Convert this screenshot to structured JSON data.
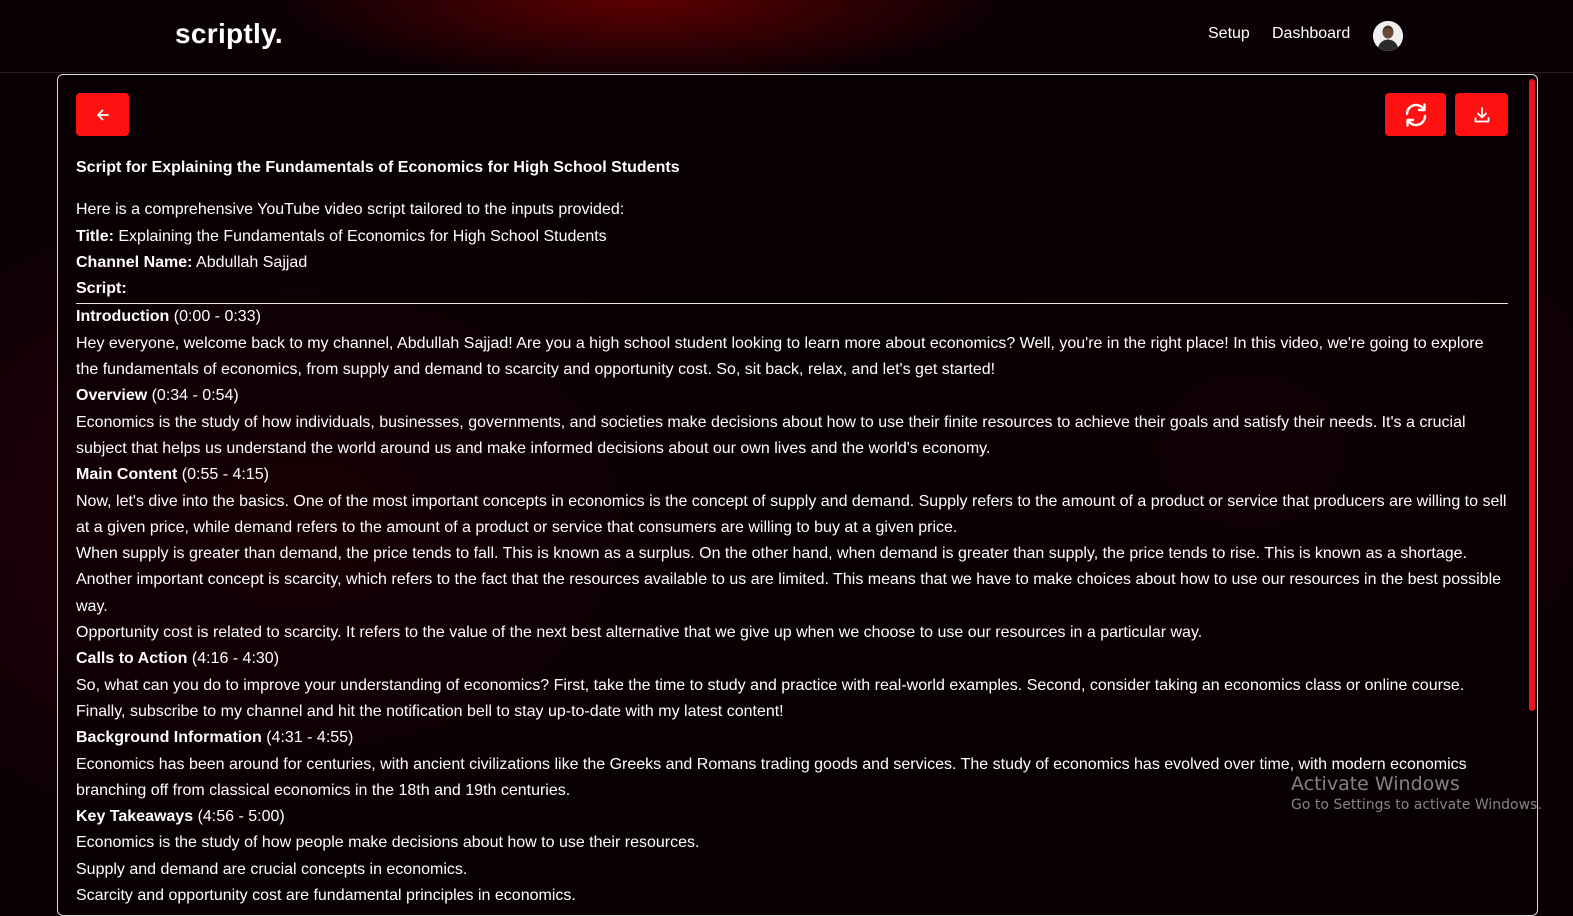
{
  "header": {
    "logo": "scriptly.",
    "nav": [
      "Setup",
      "Dashboard"
    ],
    "avatar_icon": "user-avatar"
  },
  "toolbar": {
    "back_icon": "arrow-left-icon",
    "refresh_icon": "refresh-icon",
    "download_icon": "download-icon",
    "accent_color": "#ff1111"
  },
  "script": {
    "heading": "Script for Explaining the Fundamentals of Economics for High School Students",
    "intro_line": "Here is a comprehensive YouTube video script tailored to the inputs provided:",
    "title_label": "Title:",
    "title_value": " Explaining the Fundamentals of Economics for High School Students",
    "channel_label": "Channel Name:",
    "channel_value": " Abdullah Sajjad",
    "script_label": "Script:",
    "sections": [
      {
        "label": "Introduction",
        "time": " (0:00 - 0:33)"
      },
      {
        "label": "Overview",
        "time": " (0:34 - 0:54)"
      },
      {
        "label": "Main Content",
        "time": " (0:55 - 4:15)"
      },
      {
        "label": "Calls to Action",
        "time": " (4:16 - 4:30)"
      },
      {
        "label": "Background Information",
        "time": " (4:31 - 4:55)"
      },
      {
        "label": "Key Takeaways",
        "time": " (4:56 - 5:00)"
      }
    ],
    "intro_text": "Hey everyone, welcome back to my channel, Abdullah Sajjad! Are you a high school student looking to learn more about economics? Well, you're in the right place! In this video, we're going to explore the fundamentals of economics, from supply and demand to scarcity and opportunity cost. So, sit back, relax, and let's get started!",
    "overview_text": "Economics is the study of how individuals, businesses, governments, and societies make decisions about how to use their finite resources to achieve their goals and satisfy their needs. It's a crucial subject that helps us understand the world around us and make informed decisions about our own lives and the world's economy.",
    "main_p1": "Now, let's dive into the basics. One of the most important concepts in economics is the concept of supply and demand. Supply refers to the amount of a product or service that producers are willing to sell at a given price, while demand refers to the amount of a product or service that consumers are willing to buy at a given price.",
    "main_p2": "When supply is greater than demand, the price tends to fall. This is known as a surplus. On the other hand, when demand is greater than supply, the price tends to rise. This is known as a shortage.",
    "main_p3": "Another important concept is scarcity, which refers to the fact that the resources available to us are limited. This means that we have to make choices about how to use our resources in the best possible way.",
    "main_p4": "Opportunity cost is related to scarcity. It refers to the value of the next best alternative that we give up when we choose to use our resources in a particular way.",
    "cta_text": "So, what can you do to improve your understanding of economics? First, take the time to study and practice with real-world examples. Second, consider taking an economics class or online course. Finally, subscribe to my channel and hit the notification bell to stay up-to-date with my latest content!",
    "background_text": "Economics has been around for centuries, with ancient civilizations like the Greeks and Romans trading goods and services. The study of economics has evolved over time, with modern economics branching off from classical economics in the 18th and 19th centuries.",
    "takeaways": [
      "Economics is the study of how people make decisions about how to use their resources.",
      "Supply and demand are crucial concepts in economics.",
      "Scarcity and opportunity cost are fundamental principles in economics."
    ]
  },
  "watermark": {
    "title": "Activate Windows",
    "subtitle": "Go to Settings to activate Windows."
  }
}
